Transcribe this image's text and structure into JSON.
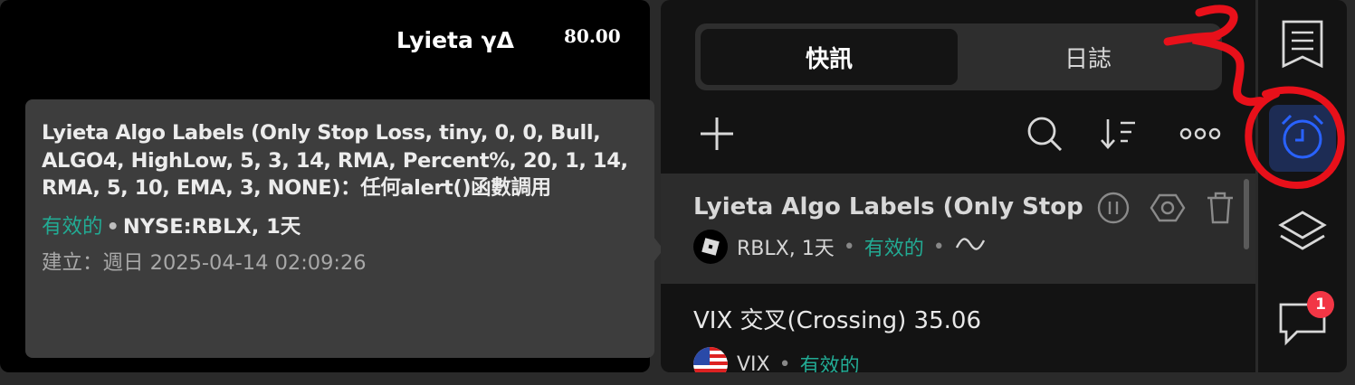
{
  "chart": {
    "label": "Lyieta γΔ",
    "price": "80.00"
  },
  "tooltip": {
    "title": "Lyieta Algo Labels (Only Stop Loss, tiny, 0, 0, Bull, ALGO4, HighLow, 5, 3, 14, RMA, Percent%, 20, 1, 14, RMA, 5, 10, EMA, 3, NONE)：任何alert()函數調用",
    "status": "有效的",
    "separator": "•",
    "symbol": "NYSE:RBLX, 1天",
    "created": "建立：週日 2025-04-14   02:09:26"
  },
  "panel": {
    "tabs": [
      {
        "label": "快訊",
        "active": true
      },
      {
        "label": "日誌",
        "active": false
      }
    ],
    "toolbar": {
      "add_icon": "plus-icon",
      "search_icon": "search-icon",
      "sort_icon": "sort-icon",
      "more_icon": "more-icon"
    },
    "alerts": [
      {
        "title": "Lyieta Algo Labels (Only Stop",
        "symbol": "RBLX, 1天",
        "status": "有效的",
        "separator": "•",
        "trigger_icon": "wave-icon"
      },
      {
        "title": "VIX 交叉(Crossing) 35.06",
        "symbol": "VIX",
        "status": "有效的",
        "separator": "•"
      }
    ]
  },
  "sidebar": {
    "items": [
      {
        "name": "watchlist",
        "icon": "list-icon"
      },
      {
        "name": "alerts",
        "icon": "alarm-clock-icon",
        "active": true
      },
      {
        "name": "layers",
        "icon": "layers-icon"
      },
      {
        "name": "chat",
        "icon": "chat-icon",
        "badge": "1"
      }
    ]
  },
  "colors": {
    "green": "#22ab94",
    "accent_bg": "#1d2c54",
    "accent_icon": "#2962ff",
    "badge": "#f23645",
    "annotation": "#e8101a"
  }
}
